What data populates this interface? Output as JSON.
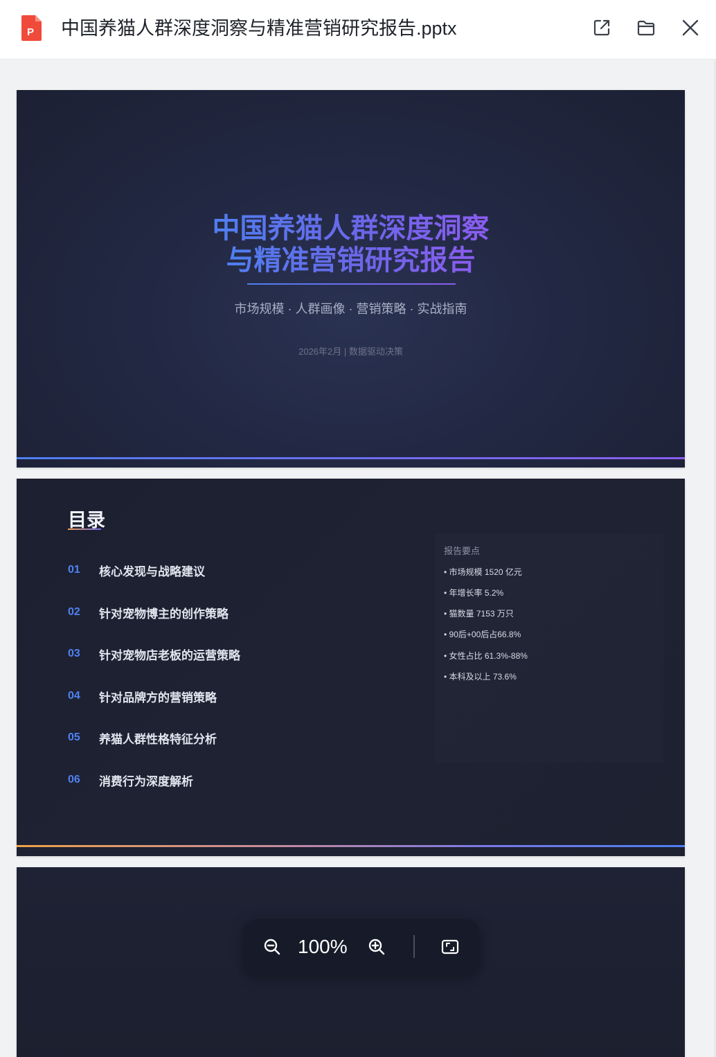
{
  "window": {
    "file_name": "中国养猫人群深度洞察与精准营销研究报告.pptx",
    "file_type_badge": "P"
  },
  "slides": [
    {
      "title_line1": "中国养猫人群深度洞察",
      "title_line2": "与精准营销研究报告",
      "subtitle": "市场规模 · 人群画像 · 营销策略 · 实战指南",
      "date": "2026年2月 | 数据驱动决策"
    },
    {
      "title": "目录",
      "toc": [
        {
          "num": "01",
          "label": "核心发现与战略建议"
        },
        {
          "num": "02",
          "label": "针对宠物博主的创作策略"
        },
        {
          "num": "03",
          "label": "针对宠物店老板的运营策略"
        },
        {
          "num": "04",
          "label": "针对品牌方的营销策略"
        },
        {
          "num": "05",
          "label": "养猫人群性格特征分析"
        },
        {
          "num": "06",
          "label": "消费行为深度解析"
        }
      ],
      "summary_title": "报告要点",
      "summary": [
        "• 市场规模 1520 亿元",
        "• 年增长率 5.2%",
        "• 猫数量 7153 万只",
        "• 90后+00后占66.8%",
        "• 女性占比 61.3%-88%",
        "• 本科及以上 73.6%"
      ]
    }
  ],
  "zoom": {
    "level": "100%"
  },
  "colors": {
    "accent_blue": "#4f7ff0",
    "accent_purple": "#8b5cf0",
    "accent_orange": "#f0a04b",
    "file_icon_red": "#f04a3a"
  },
  "icons": {
    "file": "pptx-file-icon",
    "open_external": "open-external-icon",
    "folder": "folder-icon",
    "close": "close-icon",
    "zoom_out": "zoom-out-icon",
    "zoom_in": "zoom-in-icon",
    "fit": "fit-screen-icon"
  }
}
